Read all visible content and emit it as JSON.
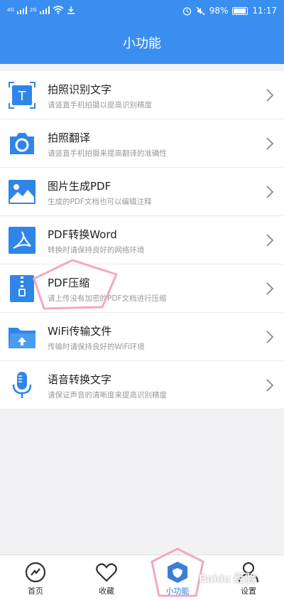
{
  "status": {
    "net1": "4G",
    "net2": "2G",
    "battery": "98%",
    "time": "11:17"
  },
  "header": {
    "title": "小功能"
  },
  "features": [
    {
      "title": "拍照识别文字",
      "subtitle": "请竖直手机拍摄以提高识别精度",
      "icon": "text-recognition-icon"
    },
    {
      "title": "拍照翻译",
      "subtitle": "请竖直手机拍摄来提高翻译的准确性",
      "icon": "camera-icon"
    },
    {
      "title": "图片生成PDF",
      "subtitle": "生成的PDF文档也可以编辑注释",
      "icon": "image-icon"
    },
    {
      "title": "PDF转换Word",
      "subtitle": "转换时请保持良好的网络环境",
      "icon": "pdf-icon"
    },
    {
      "title": "PDF压缩",
      "subtitle": "请上传没有加密的PDF文档进行压缩",
      "icon": "zip-icon"
    },
    {
      "title": "WiFi传输文件",
      "subtitle": "传输时请保持良好的WiFi环境",
      "icon": "folder-upload-icon"
    },
    {
      "title": "语音转换文字",
      "subtitle": "请保证声音的清晰度来提高识别精度",
      "icon": "microphone-icon"
    }
  ],
  "tabs": [
    {
      "label": "首页",
      "icon": "home-icon",
      "active": false
    },
    {
      "label": "收藏",
      "icon": "heart-icon",
      "active": false
    },
    {
      "label": "小功能",
      "icon": "shield-icon",
      "active": true
    },
    {
      "label": "设置",
      "icon": "user-icon",
      "active": false
    }
  ],
  "watermark": "Baidu 经验",
  "colors": {
    "primary": "#3a8ef0",
    "icon_blue": "#2f86e8",
    "annotation_pink": "#f2a8c0"
  }
}
